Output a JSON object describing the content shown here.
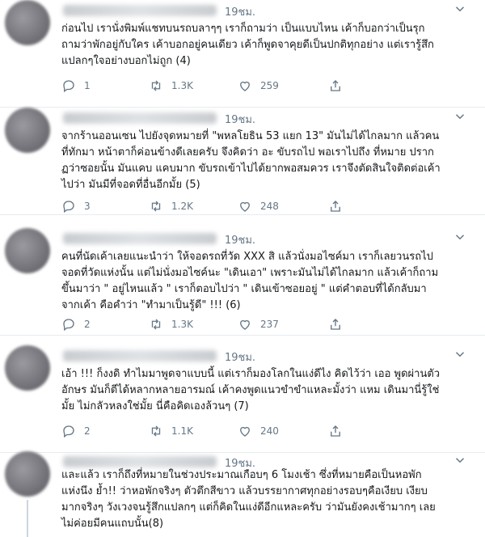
{
  "tweets": [
    {
      "time": "19ชม.",
      "text": "ก่อนไป เรานั่งพิมพ์แชทบนรถบลาๆๆ เราก็ถามว่า เป็นแบบไหน เค้าก็บอกว่าเป็นรุก\nถามว่าพักอยู่กับใคร เค้าบอกอยู่คนเดียว เค้าก็พูดจาคุยดีเป็นปกติทุกอย่าง แต่เรารู้สึก\nแปลกๆใจอย่างบอกไม่ถูก (4)",
      "replies": "1",
      "retweets": "1.3K",
      "likes": "259"
    },
    {
      "time": "19ชม.",
      "text": "จากร้านออนเซน ไปยังจุดหมายที่ \"พหลโยธิน 53 แยก 13\" มันไม่ได้ไกลมาก แล้วคน\nที่ทักมา หน้าตาก็ค่อนข้างดีเลยครับ จึงคิดว่า อะ ขับรถไป พอเราไปถึง ที่หมาย ปราก\nฏว่าซอยนั้น มันแคบ แคบมาก ขับรถเข้าไปได้ยากพอสมควร เราจึงตัดสินใจติดต่อเค้า\nไปว่า มันมีที่จอดที่อื่นอีกมั้ย (5)",
      "replies": "3",
      "retweets": "1.2K",
      "likes": "248"
    },
    {
      "time": "19ชม.",
      "text": "คนที่นัดเค้าเลยแนะนำว่า ให้จอดรถที่วัด XXX สิ แล้วนั่งมอไซค์มา เราก็เลยวนรถไป\nจอดที่วัดแห่งนั้น แต่ไม่นั่งมอไซค์นะ \"เดินเอา\" เพราะมันไม่ได้ไกลมาก แล้วเค้าก็ถาม\nขึ้นมาว่า \" อยู่ไหนแล้ว \" เราก็ตอบไปว่า \" เดินเข้าซอยอยู่ \" แต่คำตอบที่ได้กลับมา\nจากเค้า คือคำว่า \"ทำมาเป็นรู้ดี\" !!! (6)",
      "replies": "2",
      "retweets": "1.3K",
      "likes": "237"
    },
    {
      "time": "19ชม.",
      "text": "เอ้า !!! ก็งงดิ ทำไมมาพูดจาแบบนี้ แต่เราก็มองโลกในแง่ดีไง คิดไว้ว่า เออ พูดผ่านตัว\nอักษร มันก็ตีได้หลากหลายอารมณ์ เค้าคงพูดแนวขำขำแหละมั้งว่า แหม เดินมานี่รู้ใช่\nมั้ย ไม่กลัวหลงใช่มั้ย นี่คือคิดเองล้วนๆ (7)",
      "replies": "2",
      "retweets": "1.1K",
      "likes": "240"
    },
    {
      "time": "19ชม.",
      "text": "และแล้ว เราก็ถึงที่หมายในช่วงประมาณเกือบๆ 6 โมงเช้า ซึ่งที่หมายคือเป็นหอพัก\nแห่งนึง ย้ำ!! ว่าหอพักจริงๆ ตัวตึกสีขาว แล้วบรรยากาศทุกอย่างรอบๆคือเงียบ เงียบ\nมากจริงๆ วังเวงจนรู้สึกแปลกๆ แต่ก็คิดในแง่ดีอีกแหละครับ ว่ามันยังคงเช้ามากๆ เลย\nไม่ค่อยมีคนแถบนั้น(8)",
      "replies": "",
      "retweets": "",
      "likes": ""
    }
  ],
  "icons": {
    "reply": "reply-icon",
    "retweet": "retweet-icon",
    "like": "heart-icon",
    "share": "share-icon",
    "more": "chevron-down-icon"
  },
  "colors": {
    "text": "#14171a",
    "muted": "#657786",
    "divider": "#e6ecf0"
  }
}
